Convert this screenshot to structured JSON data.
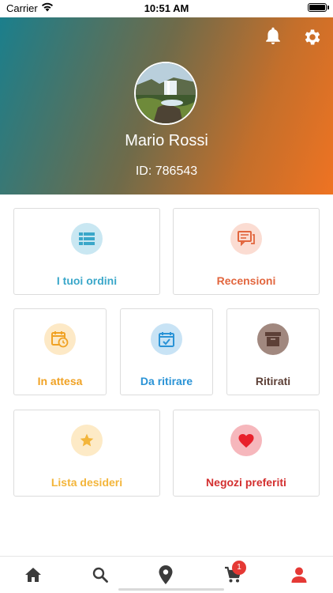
{
  "status_bar": {
    "carrier": "Carrier",
    "time": "10:51 AM"
  },
  "profile": {
    "name": "Mario Rossi",
    "id_text": "ID: 786543"
  },
  "colors": {
    "header_gradient": [
      "#1b7f8c",
      "#6f6b4a",
      "#ef7322"
    ],
    "orders": "#3aa7c9",
    "reviews": "#e2663e",
    "pending": "#f0a224",
    "to_collect": "#2a93d6",
    "collected": "#795548",
    "wishlist": "#f3b53a",
    "favorite_shops": "#d32f2f",
    "nav_active": "#e53935"
  },
  "menu": {
    "orders": {
      "label": "I tuoi ordini",
      "icon": "list-icon"
    },
    "reviews": {
      "label": "Recensioni",
      "icon": "comments-icon"
    },
    "pending": {
      "label": "In attesa",
      "icon": "calendar-clock-icon"
    },
    "to_collect": {
      "label": "Da ritirare",
      "icon": "calendar-check-icon"
    },
    "collected": {
      "label": "Ritirati",
      "icon": "archive-icon"
    },
    "wishlist": {
      "label": "Lista desideri",
      "icon": "star-icon"
    },
    "favorite_shops": {
      "label": "Negozi preferiti",
      "icon": "heart-icon"
    }
  },
  "nav": {
    "items": [
      "home-icon",
      "search-icon",
      "location-icon",
      "cart-icon",
      "user-icon"
    ],
    "cart_badge": "1"
  }
}
